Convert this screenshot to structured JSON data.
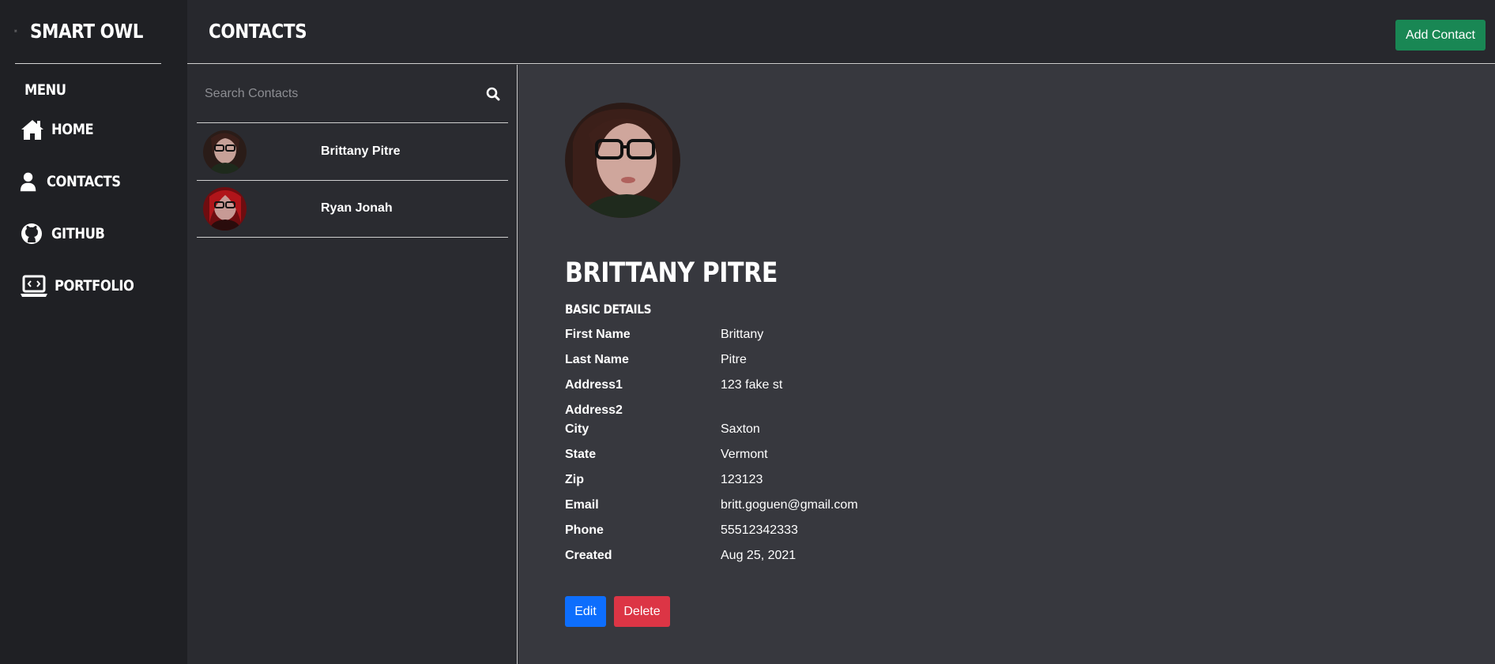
{
  "brand": {
    "name": "SMART OWL",
    "icon": "owl-logo-icon"
  },
  "sidebar": {
    "menu_title": "MENU",
    "items": [
      {
        "label": "HOME",
        "icon": "home-icon"
      },
      {
        "label": "CONTACTS",
        "icon": "user-icon"
      },
      {
        "label": "GITHUB",
        "icon": "github-icon"
      },
      {
        "label": "PORTFOLIO",
        "icon": "laptop-code-icon"
      }
    ]
  },
  "header": {
    "title": "CONTACTS",
    "add_label": "Add Contact"
  },
  "search": {
    "placeholder": "Search Contacts",
    "icon": "search-icon"
  },
  "contacts": [
    {
      "name": "Brittany Pitre"
    },
    {
      "name": "Ryan Jonah"
    }
  ],
  "detail": {
    "name": "BRITTANY PITRE",
    "section_title": "BASIC DETAILS",
    "fields": [
      {
        "label": "First Name",
        "value": "Brittany"
      },
      {
        "label": "Last Name",
        "value": "Pitre"
      },
      {
        "label": "Address1",
        "value": "123 fake st"
      },
      {
        "label": "Address2",
        "value": ""
      },
      {
        "label": "City",
        "value": "Saxton"
      },
      {
        "label": "State",
        "value": "Vermont"
      },
      {
        "label": "Zip",
        "value": "123123"
      },
      {
        "label": "Email",
        "value": "britt.goguen@gmail.com"
      },
      {
        "label": "Phone",
        "value": "55512342333"
      },
      {
        "label": "Created",
        "value": "Aug 25, 2021"
      }
    ],
    "edit_label": "Edit",
    "delete_label": "Delete"
  },
  "colors": {
    "add": "#198754",
    "edit": "#0d6efd",
    "delete": "#dc3545"
  }
}
